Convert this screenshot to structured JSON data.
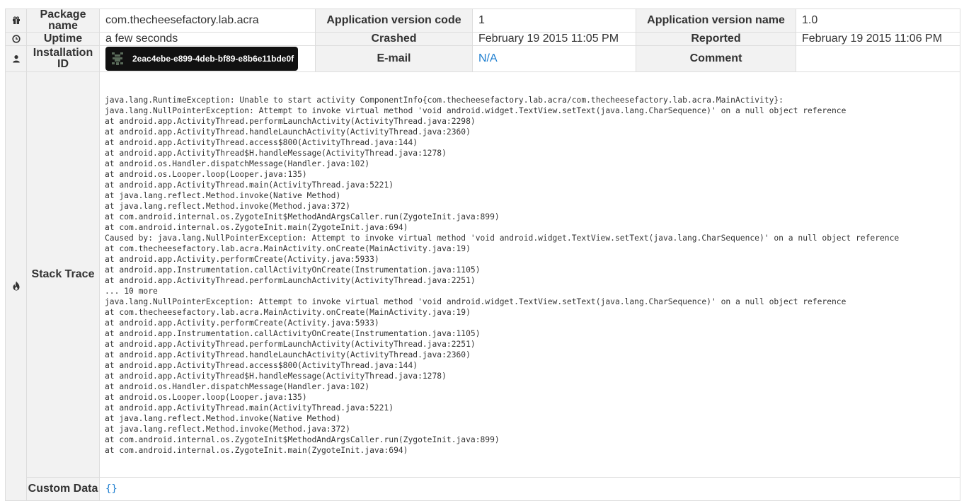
{
  "report": {
    "package_name": {
      "label": "Package name",
      "value": "com.thecheesefactory.lab.acra",
      "icon": "gift-icon"
    },
    "app_version_code": {
      "label": "Application version code",
      "value": "1"
    },
    "app_version_name": {
      "label": "Application version name",
      "value": "1.0"
    },
    "uptime": {
      "label": "Uptime",
      "value": "a few seconds",
      "icon": "clock-icon"
    },
    "crashed": {
      "label": "Crashed",
      "value": "February 19 2015 11:05 PM"
    },
    "reported": {
      "label": "Reported",
      "value": "February 19 2015 11:06 PM"
    },
    "installation_id": {
      "label": "Installation ID",
      "value": "2eac4ebe-e899-4deb-bf89-e8b6e11bde0f",
      "icon": "user-icon"
    },
    "email": {
      "label": "E-mail",
      "value": "N/A"
    },
    "comment": {
      "label": "Comment",
      "value": ""
    },
    "stack_trace": {
      "label": "Stack Trace",
      "icon": "fire-icon",
      "lines": [
        "java.lang.RuntimeException: Unable to start activity ComponentInfo{com.thecheesefactory.lab.acra/com.thecheesefactory.lab.acra.MainActivity}:",
        "java.lang.NullPointerException: Attempt to invoke virtual method 'void android.widget.TextView.setText(java.lang.CharSequence)' on a null object reference",
        "at android.app.ActivityThread.performLaunchActivity(ActivityThread.java:2298)",
        "at android.app.ActivityThread.handleLaunchActivity(ActivityThread.java:2360)",
        "at android.app.ActivityThread.access$800(ActivityThread.java:144)",
        "at android.app.ActivityThread$H.handleMessage(ActivityThread.java:1278)",
        "at android.os.Handler.dispatchMessage(Handler.java:102)",
        "at android.os.Looper.loop(Looper.java:135)",
        "at android.app.ActivityThread.main(ActivityThread.java:5221)",
        "at java.lang.reflect.Method.invoke(Native Method)",
        "at java.lang.reflect.Method.invoke(Method.java:372)",
        "at com.android.internal.os.ZygoteInit$MethodAndArgsCaller.run(ZygoteInit.java:899)",
        "at com.android.internal.os.ZygoteInit.main(ZygoteInit.java:694)",
        "Caused by: java.lang.NullPointerException: Attempt to invoke virtual method 'void android.widget.TextView.setText(java.lang.CharSequence)' on a null object reference",
        "at com.thecheesefactory.lab.acra.MainActivity.onCreate(MainActivity.java:19)",
        "at android.app.Activity.performCreate(Activity.java:5933)",
        "at android.app.Instrumentation.callActivityOnCreate(Instrumentation.java:1105)",
        "at android.app.ActivityThread.performLaunchActivity(ActivityThread.java:2251)",
        "... 10 more",
        "java.lang.NullPointerException: Attempt to invoke virtual method 'void android.widget.TextView.setText(java.lang.CharSequence)' on a null object reference",
        "at com.thecheesefactory.lab.acra.MainActivity.onCreate(MainActivity.java:19)",
        "at android.app.Activity.performCreate(Activity.java:5933)",
        "at android.app.Instrumentation.callActivityOnCreate(Instrumentation.java:1105)",
        "at android.app.ActivityThread.performLaunchActivity(ActivityThread.java:2251)",
        "at android.app.ActivityThread.handleLaunchActivity(ActivityThread.java:2360)",
        "at android.app.ActivityThread.access$800(ActivityThread.java:144)",
        "at android.app.ActivityThread$H.handleMessage(ActivityThread.java:1278)",
        "at android.os.Handler.dispatchMessage(Handler.java:102)",
        "at android.os.Looper.loop(Looper.java:135)",
        "at android.app.ActivityThread.main(ActivityThread.java:5221)",
        "at java.lang.reflect.Method.invoke(Native Method)",
        "at java.lang.reflect.Method.invoke(Method.java:372)",
        "at com.android.internal.os.ZygoteInit$MethodAndArgsCaller.run(ZygoteInit.java:899)",
        "at com.android.internal.os.ZygoteInit.main(ZygoteInit.java:694)"
      ]
    },
    "custom_data": {
      "label": "Custom Data",
      "value": "{}"
    }
  },
  "colors": {
    "label_bg": "#f2f2f2",
    "border": "#dddddd",
    "link": "#1f7fd0",
    "badge_bg": "#111111"
  }
}
